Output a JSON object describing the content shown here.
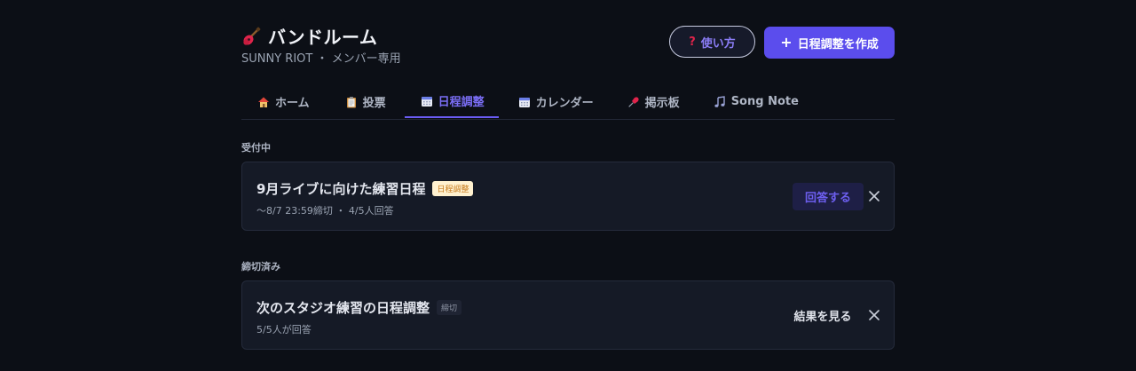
{
  "header": {
    "title": "バンドルーム",
    "subtitle": "SUNNY RIOT ・ メンバー専用",
    "title_icon": "guitar-icon",
    "help_button": {
      "icon": "question-icon",
      "label": "使い方"
    },
    "create_button": {
      "icon": "plus-icon",
      "label": "日程調整を作成"
    }
  },
  "tabs": [
    {
      "icon": "house-icon",
      "label": "ホーム",
      "active": false
    },
    {
      "icon": "clipboard-icon",
      "label": "投票",
      "active": false
    },
    {
      "icon": "calendar-icon",
      "label": "日程調整",
      "active": true
    },
    {
      "icon": "calendar-icon",
      "label": "カレンダー",
      "active": false
    },
    {
      "icon": "pushpin-icon",
      "label": "掲示板",
      "active": false
    },
    {
      "icon": "music-note-icon",
      "label": "Song Note",
      "active": false
    }
  ],
  "sections": {
    "open": {
      "label": "受付中",
      "card": {
        "title": "9月ライブに向けた練習日程",
        "badge": "日程調整",
        "meta": "〜8/7 23:59締切 ・ 4/5人回答",
        "action": "回答する"
      }
    },
    "closed": {
      "label": "締切済み",
      "card": {
        "title": "次のスタジオ練習の日程調整",
        "badge": "締切",
        "meta": "5/5人が回答",
        "action": "結果を見る"
      }
    }
  },
  "colors": {
    "background": "#0c0f16",
    "accent": "#5b4ded",
    "card": "#151a26",
    "badge_open_bg": "#fff1cf",
    "badge_open_text": "#c77b1c"
  }
}
